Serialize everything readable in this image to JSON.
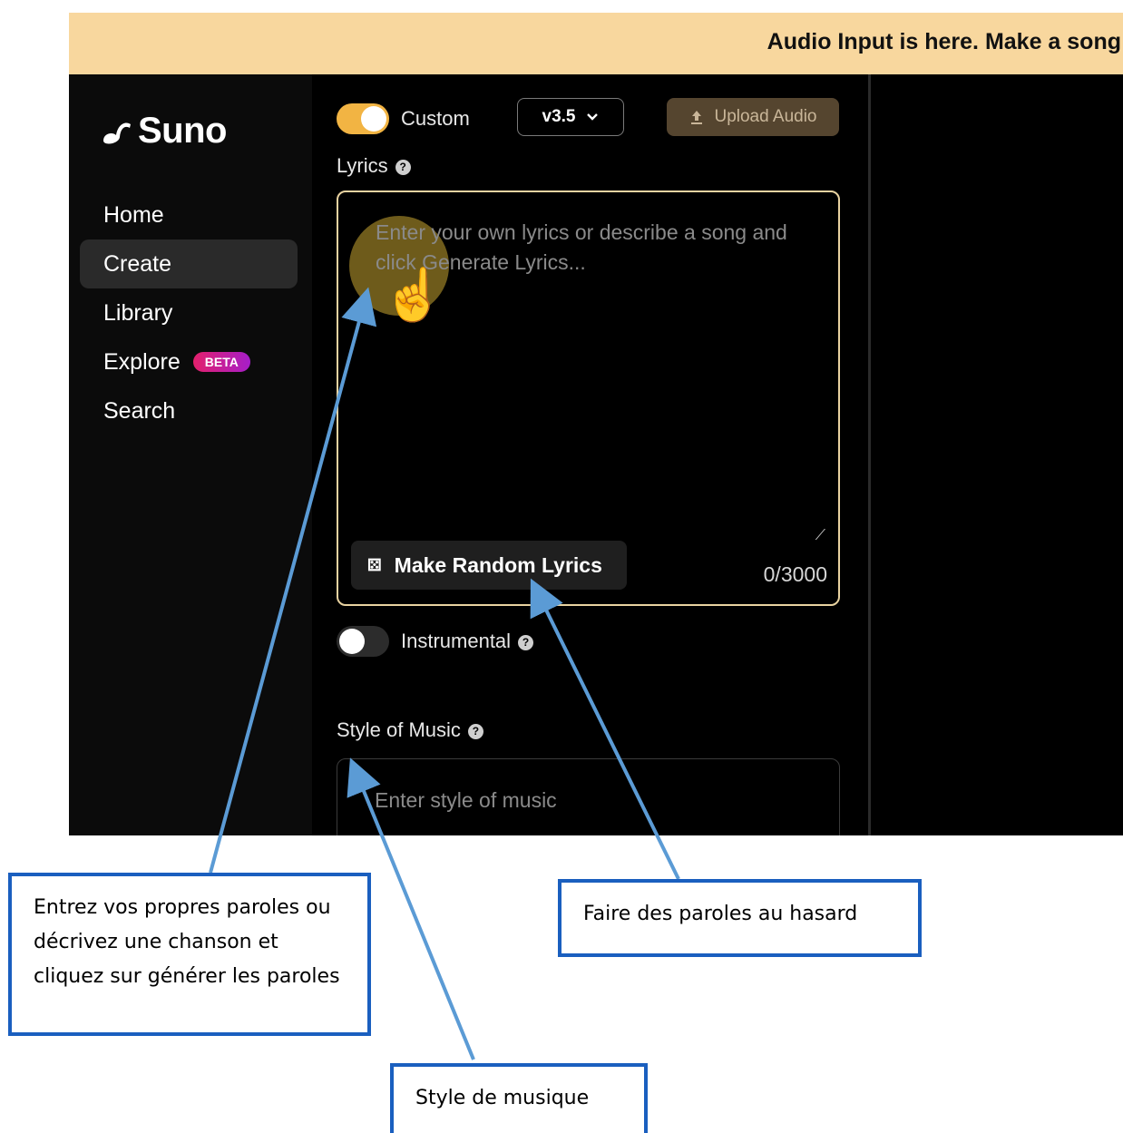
{
  "banner": {
    "text": "Audio Input is here. Make a song"
  },
  "sidebar": {
    "logo_text": "Suno",
    "items": [
      {
        "label": "Home"
      },
      {
        "label": "Create"
      },
      {
        "label": "Library"
      },
      {
        "label": "Explore",
        "badge": "BETA"
      },
      {
        "label": "Search"
      }
    ]
  },
  "create": {
    "custom_toggle": {
      "label": "Custom",
      "state": "on"
    },
    "version": {
      "value": "v3.5"
    },
    "upload_label": "Upload Audio",
    "lyrics": {
      "label": "Lyrics",
      "placeholder": "Enter your own lyrics or describe a song and click Generate Lyrics...",
      "random_button_label": "Make Random Lyrics",
      "counter": "0/3000"
    },
    "instrumental_toggle": {
      "label": "Instrumental",
      "state": "off"
    },
    "style": {
      "label": "Style of Music",
      "placeholder": "Enter style of music"
    }
  },
  "annotations": {
    "lyrics_callout": "Entrez vos propres paroles ou décrivez une chanson et cliquez sur générer les paroles",
    "random_callout": "Faire des paroles au hasard",
    "style_callout": "Style de musique"
  },
  "colors": {
    "banner": "#f8d79e",
    "accent_toggle": "#f2b443",
    "lyrics_border": "#e9d3a1",
    "annotation_border": "#1a5fbf",
    "arrow": "#5b9bd5"
  }
}
